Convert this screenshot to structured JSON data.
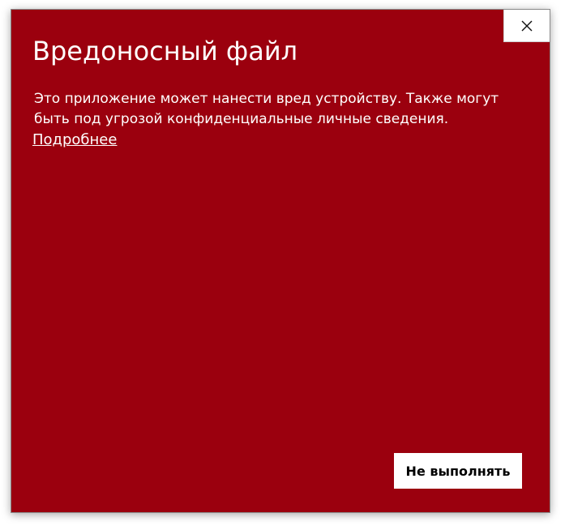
{
  "dialog": {
    "title": "Вредоносный файл",
    "message": "Это приложение может нанести вред устройству. Также могут быть под угрозой конфиденциальные личные сведения.",
    "more_link": "Подробнее",
    "dont_run_label": "Не выполнять",
    "close_icon": "close-icon",
    "background_color": "#9b000e"
  }
}
